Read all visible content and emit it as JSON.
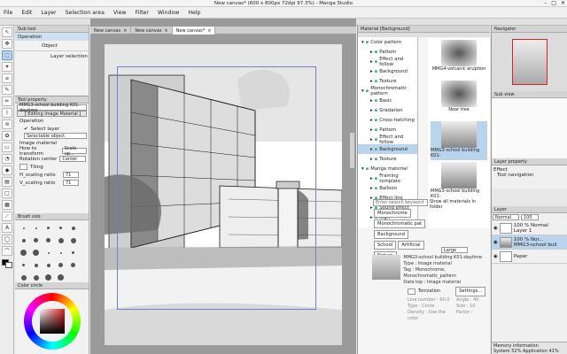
{
  "app": {
    "title": "New canvas* (600 x 800px 72dpi 97.3%) - Manga Studio",
    "menu": [
      "File",
      "Edit",
      "Layer",
      "Selection area",
      "View",
      "Filter",
      "Window",
      "Help"
    ]
  },
  "subtool": {
    "header": "Sub tool",
    "header2": "Operation",
    "items": [
      "Object",
      "Layer selection"
    ]
  },
  "toolprop": {
    "header": "Tool property",
    "name": "MMG3-school building K01-daytime",
    "editing": "[ Editing Image Material ]",
    "operation_label": "Operation",
    "select_layer": "Select layer",
    "selectable_object": "Selectable object",
    "image_material": "Image material",
    "how_to_transform_label": "How to transform",
    "how_to_transform_value": "Scale up...",
    "rotation_label": "Rotation center",
    "rotation_value": "Center",
    "tiling": "Tiling",
    "h_scaling": "H_scaling ratio",
    "h_scaling_val": "71",
    "v_scaling": "V_scaling ratio",
    "v_scaling_val": "71"
  },
  "brushsize": {
    "header": "Brush size"
  },
  "color": {
    "header": "Color circle"
  },
  "tabs": [
    "New canvas",
    "New canvas",
    "New canvas*"
  ],
  "material": {
    "header": "Material [Background]",
    "tree": [
      "Color pattern",
      "Pattern",
      "Effect and fellow",
      "Background",
      "Texture",
      "Monochromatic pattern",
      "Basic",
      "Gradation",
      "Cross-hatching",
      "Pattern",
      "Effect and fellow",
      "Background",
      "Texture",
      "Manga material",
      "Framing template",
      "Balloon",
      "Effect line",
      "Sound effect",
      "Sign"
    ],
    "thumbs": [
      "MMG4-volcanic eruption",
      "Near tree",
      "MMG3-school building K01-",
      "MMG3-school building K01-"
    ],
    "search_placeholder": "Enter search keyword",
    "show_all": "Show all materials in folder",
    "tags": [
      "Monochrome",
      "Monochromatic pat",
      "Background",
      "School",
      "Artificial",
      "Nature"
    ],
    "size": "Large",
    "detail_name": "MMG3-school building K01-daytime",
    "detail_type": "Type : Image material",
    "detail_tag": "Tag : Monochrome, Monochromatic_pattern",
    "detail_datatop": "Data top : Image material",
    "tonization": "Tonization",
    "settings": "Settings...",
    "lines": "Line number : 60.0",
    "angle": "Angle : 45",
    "type_circle": "Type : Circle",
    "size_label": "Size : 10",
    "density": "Density : Use the color",
    "factor": "Factor :"
  },
  "right": {
    "navigator": "Navigator",
    "subview": "Sub view",
    "layerprop": "Layer property",
    "effect": "Effect",
    "tool_nav": "Tool navigation",
    "layer": "Layer",
    "blend": "Normal",
    "opacity": "100",
    "layers": [
      {
        "name": "100 % Normal",
        "sub": "Layer 1"
      },
      {
        "name": "100 % Nor...",
        "sub": "MMG3-school buil"
      },
      {
        "name": "Paper",
        "sub": ""
      }
    ],
    "memory": "Memory information",
    "memory_sys": "System 52%",
    "memory_app": "Application 41%"
  }
}
